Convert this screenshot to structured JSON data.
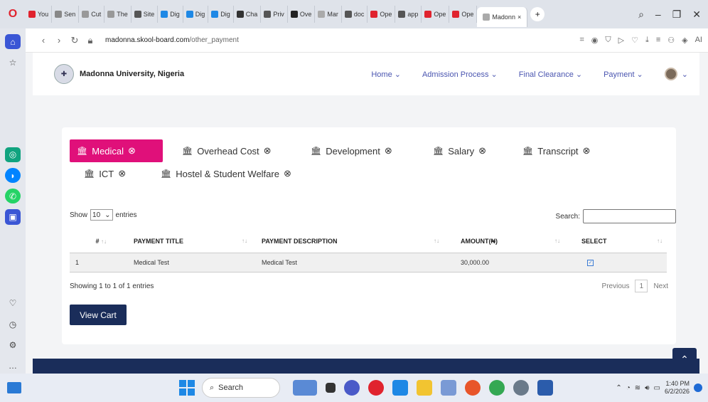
{
  "browser": {
    "tabs": [
      "You",
      "Sen",
      "Cut",
      "The",
      "Site",
      "Dig",
      "Dig",
      "Dig",
      "Cha",
      "Priv",
      "Ove",
      "Mar",
      "doc",
      "Ope",
      "app",
      "Ope",
      "Ope",
      "Madonn"
    ],
    "url_domain": "madonna.skool-board.com",
    "url_path": "/other_payment",
    "url_right_label": "AI"
  },
  "site": {
    "name": "Madonna University, Nigeria",
    "nav": [
      "Home ⌄",
      "Admission Process ⌄",
      "Final Clearance ⌄",
      "Payment ⌄"
    ]
  },
  "payment_tabs": [
    {
      "label": "Medical"
    },
    {
      "label": "Overhead Cost"
    },
    {
      "label": "Development"
    },
    {
      "label": "Salary"
    },
    {
      "label": "Transcript"
    },
    {
      "label": "ICT"
    },
    {
      "label": "Hostel & Student Welfare"
    }
  ],
  "table": {
    "show_label": "Show",
    "entries_label": "entries",
    "length_value": "10",
    "search_label": "Search:",
    "headers": [
      "#",
      "PAYMENT TITLE",
      "PAYMENT DESCRIPTION",
      "AMOUNT(₦)",
      "SELECT"
    ],
    "rows": [
      {
        "num": "1",
        "title": "Medical Test",
        "description": "Medical Test",
        "amount": "30,000.00"
      }
    ],
    "info": "Showing 1 to 1 of 1 entries",
    "prev": "Previous",
    "page": "1",
    "next": "Next"
  },
  "view_cart": "View Cart",
  "taskbar": {
    "search": "Search",
    "time": "1:40 PM",
    "date": "6/2/2026"
  }
}
